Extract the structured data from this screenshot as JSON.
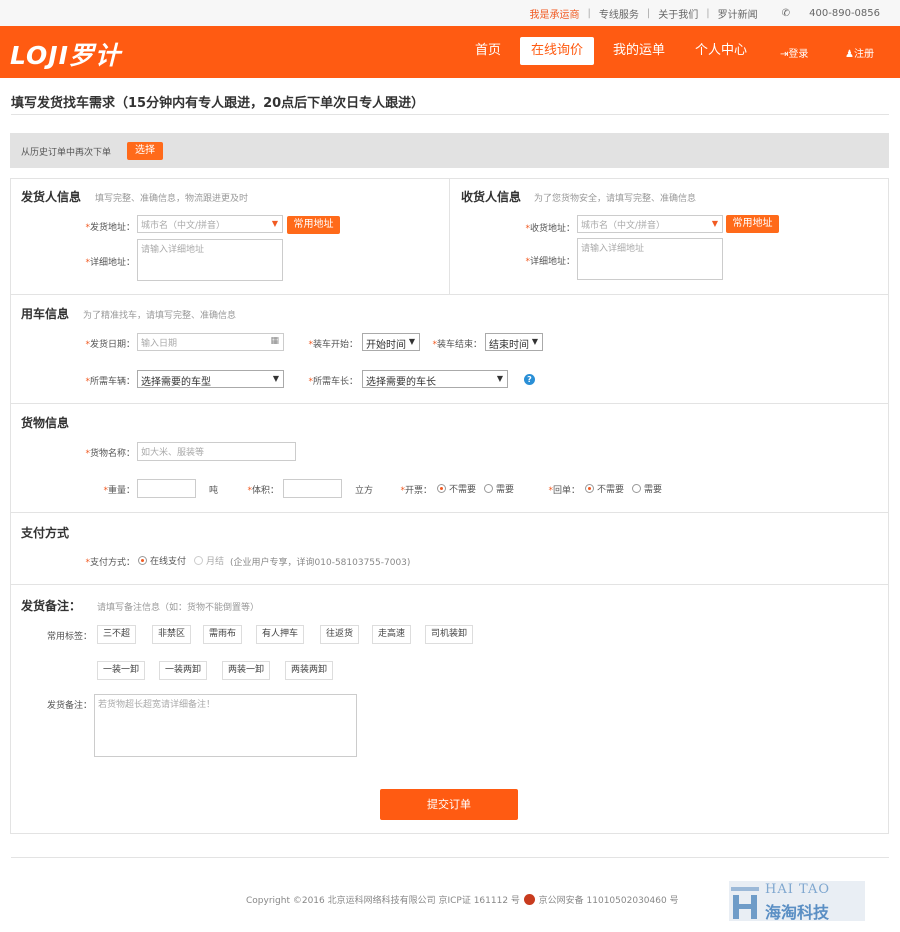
{
  "topbar": {
    "links": [
      "我是承运商",
      "专线服务",
      "关于我们",
      "罗计新闻"
    ],
    "phone": "400-890-0856"
  },
  "header": {
    "logo": "LOJI罗计",
    "nav": [
      "首页",
      "在线询价",
      "我的运单",
      "个人中心"
    ],
    "login": "登录",
    "register": "注册"
  },
  "page": {
    "title": "填写发货找车需求（15分钟内有专人跟进，20点后下单次日专人跟进）"
  },
  "history": {
    "label": "从历史订单中再次下单",
    "button": "选择"
  },
  "sender": {
    "title": "发货人信息",
    "hint": "填写完整、准确信息，物流跟进更及时",
    "address_label": "发货地址：",
    "address_placeholder": "城市名（中文/拼音）",
    "common_btn": "常用地址",
    "detail_label": "详细地址：",
    "detail_placeholder": "请输入详细地址"
  },
  "receiver": {
    "title": "收货人信息",
    "hint": "为了您货物安全，请填写完整、准确信息",
    "address_label": "收货地址：",
    "address_placeholder": "城市名（中文/拼音）",
    "common_btn": "常用地址",
    "detail_label": "详细地址：",
    "detail_placeholder": "请输入详细地址"
  },
  "vehicle": {
    "title": "用车信息",
    "hint": "为了精准找车，请填写完整、准确信息",
    "date_label": "发货日期：",
    "date_placeholder": "输入日期",
    "start_label": "装车开始：",
    "start_value": "开始时间",
    "end_label": "装车结束：",
    "end_value": "结束时间",
    "type_label": "所需车辆：",
    "type_value": "选择需要的车型",
    "length_label": "所需车长：",
    "length_value": "选择需要的车长"
  },
  "cargo": {
    "title": "货物信息",
    "name_label": "货物名称：",
    "name_placeholder": "如大米、服装等",
    "weight_label": "重量：",
    "weight_unit": "吨",
    "volume_label": "体积：",
    "volume_unit": "立方",
    "invoice_label": "开票：",
    "invoice_options": [
      "不需要",
      "需要"
    ],
    "receipt_label": "回单：",
    "receipt_options": [
      "不需要",
      "需要"
    ]
  },
  "payment": {
    "title": "支付方式",
    "label": "支付方式：",
    "online": "在线支付",
    "monthly": "月结",
    "monthly_note": "(企业用户专享，详询010-58103755-7003)"
  },
  "remarks": {
    "title": "发货备注：",
    "hint": "请填写备注信息（如：货物不能倒置等）",
    "tags_label": "常用标签：",
    "tags_row1": [
      "三不超",
      "非禁区",
      "需雨布",
      "有人押车",
      "往返货",
      "走高速",
      "司机装卸"
    ],
    "tags_row2": [
      "一装一卸",
      "一装两卸",
      "两装一卸",
      "两装两卸"
    ],
    "remark_label": "发货备注：",
    "remark_placeholder": "若货物超长超宽请详细备注！"
  },
  "submit": "提交订单",
  "footer": {
    "text": "Copyright ©2016 北京运科网络科技有限公司 京ICP证 161112 号",
    "police": "京公网安备 11010502030460 号"
  },
  "watermark": {
    "en": "HAI TAO",
    "cn": "海淘科技"
  },
  "colors": {
    "brand": "#ff5b12",
    "accent_text": "#f15a22"
  }
}
